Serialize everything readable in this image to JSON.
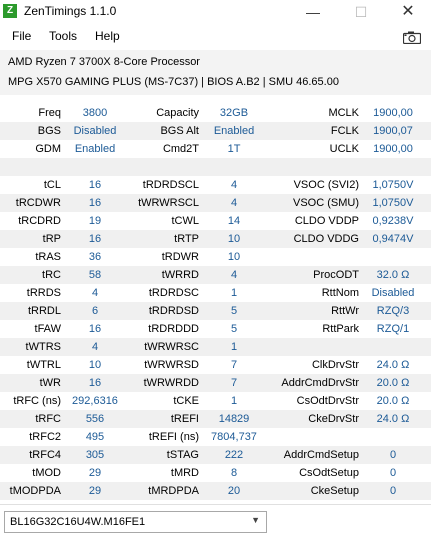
{
  "window": {
    "title": "ZenTimings 1.1.0",
    "icon_letter": "Z",
    "minimize_glyph": "—",
    "maximize_glyph": "☐",
    "close_glyph": "✕"
  },
  "menu": {
    "file": "File",
    "tools": "Tools",
    "help": "Help",
    "screenshot_icon": "camera-icon"
  },
  "system": {
    "cpu": "AMD Ryzen 7 3700X 8-Core Processor",
    "board": "MPG X570 GAMING PLUS (MS-7C37) | BIOS A.B2 | SMU 46.65.00"
  },
  "summary": [
    [
      {
        "label": "Freq",
        "value": "3800"
      },
      {
        "label": "Capacity",
        "value": "32GB"
      },
      {
        "label": "MCLK",
        "value": "1900,00"
      }
    ],
    [
      {
        "label": "BGS",
        "value": "Disabled"
      },
      {
        "label": "BGS Alt",
        "value": "Enabled"
      },
      {
        "label": "FCLK",
        "value": "1900,07"
      }
    ],
    [
      {
        "label": "GDM",
        "value": "Enabled"
      },
      {
        "label": "Cmd2T",
        "value": "1T"
      },
      {
        "label": "UCLK",
        "value": "1900,00"
      }
    ]
  ],
  "timings": [
    [
      {
        "label": "tCL",
        "value": "16"
      },
      {
        "label": "tRDRDSCL",
        "value": "4"
      },
      {
        "label": "VSOC (SVI2)",
        "value": "1,0750V"
      }
    ],
    [
      {
        "label": "tRCDWR",
        "value": "16"
      },
      {
        "label": "tWRWRSCL",
        "value": "4"
      },
      {
        "label": "VSOC (SMU)",
        "value": "1,0750V"
      }
    ],
    [
      {
        "label": "tRCDRD",
        "value": "19"
      },
      {
        "label": "tCWL",
        "value": "14"
      },
      {
        "label": "CLDO VDDP",
        "value": "0,9238V"
      }
    ],
    [
      {
        "label": "tRP",
        "value": "16"
      },
      {
        "label": "tRTP",
        "value": "10"
      },
      {
        "label": "CLDO VDDG",
        "value": "0,9474V"
      }
    ],
    [
      {
        "label": "tRAS",
        "value": "36"
      },
      {
        "label": "tRDWR",
        "value": "10"
      },
      {
        "label": "",
        "value": ""
      }
    ],
    [
      {
        "label": "tRC",
        "value": "58"
      },
      {
        "label": "tWRRD",
        "value": "4"
      },
      {
        "label": "ProcODT",
        "value": "32.0 Ω"
      }
    ],
    [
      {
        "label": "tRRDS",
        "value": "4"
      },
      {
        "label": "tRDRDSC",
        "value": "1"
      },
      {
        "label": "RttNom",
        "value": "Disabled"
      }
    ],
    [
      {
        "label": "tRRDL",
        "value": "6"
      },
      {
        "label": "tRDRDSD",
        "value": "5"
      },
      {
        "label": "RttWr",
        "value": "RZQ/3"
      }
    ],
    [
      {
        "label": "tFAW",
        "value": "16"
      },
      {
        "label": "tRDRDDD",
        "value": "5"
      },
      {
        "label": "RttPark",
        "value": "RZQ/1"
      }
    ],
    [
      {
        "label": "tWTRS",
        "value": "4"
      },
      {
        "label": "tWRWRSC",
        "value": "1"
      },
      {
        "label": "",
        "value": ""
      }
    ],
    [
      {
        "label": "tWTRL",
        "value": "10"
      },
      {
        "label": "tWRWRSD",
        "value": "7"
      },
      {
        "label": "ClkDrvStr",
        "value": "24.0 Ω"
      }
    ],
    [
      {
        "label": "tWR",
        "value": "16"
      },
      {
        "label": "tWRWRDD",
        "value": "7"
      },
      {
        "label": "AddrCmdDrvStr",
        "value": "20.0 Ω"
      }
    ],
    [
      {
        "label": "tRFC (ns)",
        "value": "292,6316"
      },
      {
        "label": "tCKE",
        "value": "1"
      },
      {
        "label": "CsOdtDrvStr",
        "value": "20.0 Ω"
      }
    ],
    [
      {
        "label": "tRFC",
        "value": "556"
      },
      {
        "label": "tREFI",
        "value": "14829"
      },
      {
        "label": "CkeDrvStr",
        "value": "24.0 Ω"
      }
    ],
    [
      {
        "label": "tRFC2",
        "value": "495"
      },
      {
        "label": "tREFI (ns)",
        "value": "7804,737"
      },
      {
        "label": "",
        "value": ""
      }
    ],
    [
      {
        "label": "tRFC4",
        "value": "305"
      },
      {
        "label": "tSTAG",
        "value": "222"
      },
      {
        "label": "AddrCmdSetup",
        "value": "0"
      }
    ],
    [
      {
        "label": "tMOD",
        "value": "29"
      },
      {
        "label": "tMRD",
        "value": "8"
      },
      {
        "label": "CsOdtSetup",
        "value": "0"
      }
    ],
    [
      {
        "label": "tMODPDA",
        "value": "29"
      },
      {
        "label": "tMRDPDA",
        "value": "20"
      },
      {
        "label": "CkeSetup",
        "value": "0"
      }
    ]
  ],
  "module_select": {
    "selected": "BL16G32C16U4W.M16FE1",
    "arrow_icon": "chevron-down-icon"
  }
}
